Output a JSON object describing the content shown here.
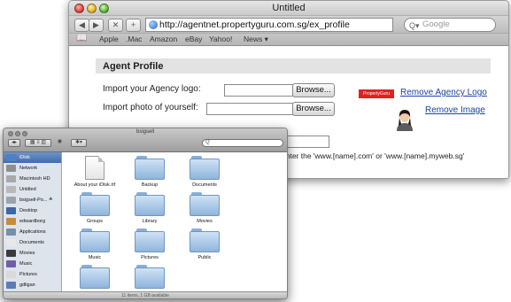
{
  "browser": {
    "title": "Untitled",
    "nav": {
      "back": "◀",
      "forward": "▶",
      "close": "✕",
      "add": "+"
    },
    "url": "http://agentnet.propertyguru.com.sg/ex_profile",
    "search_placeholder": "Google",
    "bookmarks": [
      "Apple",
      ".Mac",
      "Amazon",
      "eBay",
      "Yahoo!",
      "News ▾"
    ]
  },
  "profile": {
    "heading": "Agent Profile",
    "logo_label": "Import your Agency logo:",
    "photo_label": "Import photo of yourself:",
    "browse_label": "Browse...",
    "logo_badge_text": "PropertyGuru",
    "remove_logo": "Remove Agency Logo",
    "remove_image": "Remove Image",
    "hint": "enter the 'www.[name].com' or 'www.[name].myweb.sg'"
  },
  "finder": {
    "title": "bsigsell",
    "search_value": "Q",
    "sidebar": [
      {
        "label": "iDisk",
        "selected": true,
        "icon": "idisk-icon",
        "color": "#4f7fc4"
      },
      {
        "label": "Network",
        "icon": "network-icon",
        "color": "#8f8f8f"
      },
      {
        "label": "Macintosh HD",
        "icon": "hard-drive-icon",
        "color": "#a9a9a9"
      },
      {
        "label": "Untitled",
        "icon": "drive-icon",
        "color": "#b9b9b9"
      },
      {
        "label": "bsigsell-Po... ≙",
        "icon": "drive-icon",
        "color": "#9aa3ad"
      },
      {
        "label": "Desktop",
        "icon": "desktop-icon",
        "color": "#3e67a6"
      },
      {
        "label": "edwardborg",
        "icon": "home-icon",
        "color": "#c98b3b"
      },
      {
        "label": "Applications",
        "icon": "applications-icon",
        "color": "#7a8ea6"
      },
      {
        "label": "Documents",
        "icon": "documents-icon",
        "color": "#e8e8e8"
      },
      {
        "label": "Movies",
        "icon": "movies-icon",
        "color": "#3b3b3b"
      },
      {
        "label": "Music",
        "icon": "music-icon",
        "color": "#6f5fa8"
      },
      {
        "label": "Pictures",
        "icon": "pictures-icon",
        "color": "#d9d9d9"
      },
      {
        "label": "gdligan",
        "icon": "user-icon",
        "color": "#5a7db8"
      },
      {
        "label": "untitled folder",
        "icon": "folder-icon",
        "color": "#9dbde0"
      }
    ],
    "items": [
      {
        "label": "About your iDisk.rtf",
        "kind": "document"
      },
      {
        "label": "Backup",
        "kind": "folder"
      },
      {
        "label": "Documents",
        "kind": "folder"
      },
      {
        "label": "Groups",
        "kind": "folder"
      },
      {
        "label": "Library",
        "kind": "folder"
      },
      {
        "label": "Movies",
        "kind": "folder"
      },
      {
        "label": "Music",
        "kind": "folder"
      },
      {
        "label": "Pictures",
        "kind": "folder"
      },
      {
        "label": "Public",
        "kind": "folder"
      },
      {
        "label": "Sites",
        "kind": "folder"
      },
      {
        "label": "Software",
        "kind": "folder"
      }
    ],
    "status": "11 items, 1 GB available"
  }
}
